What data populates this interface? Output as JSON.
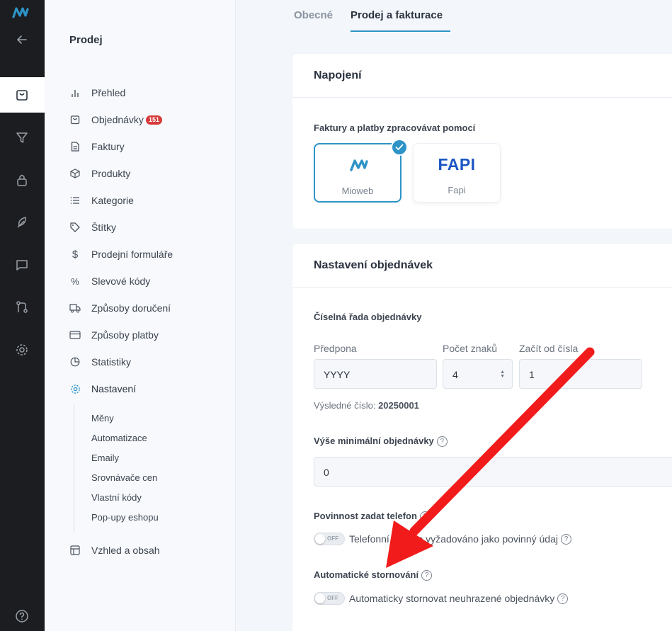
{
  "rail": {
    "icons": [
      "mioweb-logo-icon",
      "back-arrow-icon",
      "shopping-bag-icon",
      "funnel-icon",
      "lock-icon",
      "feather-icon",
      "chat-icon",
      "git-branch-icon",
      "gear-icon",
      "help-icon"
    ]
  },
  "sidebar": {
    "title": "Prodej",
    "items": [
      {
        "label": "Přehled",
        "icon": "bar-chart-icon"
      },
      {
        "label": "Objednávky",
        "icon": "bag-icon",
        "badge": "151"
      },
      {
        "label": "Faktury",
        "icon": "document-icon"
      },
      {
        "label": "Produkty",
        "icon": "box-icon"
      },
      {
        "label": "Kategorie",
        "icon": "list-icon"
      },
      {
        "label": "Štítky",
        "icon": "tag-icon"
      },
      {
        "label": "Prodejní formuláře",
        "icon": "dollar-icon"
      },
      {
        "label": "Slevové kódy",
        "icon": "percent-icon"
      },
      {
        "label": "Způsoby doručení",
        "icon": "truck-icon"
      },
      {
        "label": "Způsoby platby",
        "icon": "credit-card-icon"
      },
      {
        "label": "Statistiky",
        "icon": "pie-chart-icon"
      },
      {
        "label": "Nastavení",
        "icon": "gear-icon"
      },
      {
        "label": "Vzhled a obsah",
        "icon": "layout-icon"
      }
    ],
    "subitems": [
      "Měny",
      "Automatizace",
      "Emaily",
      "Srovnávače cen",
      "Vlastní kódy",
      "Pop-upy eshopu"
    ],
    "accent": "#2e93c6"
  },
  "tabs": [
    {
      "label": "Obecné"
    },
    {
      "label": "Prodej a fakturace"
    }
  ],
  "connection": {
    "title": "Napojení",
    "label": "Faktury a platby zpracovávat pomocí",
    "providers": [
      {
        "name": "Mioweb",
        "selected": true
      },
      {
        "name": "Fapi",
        "logo_text": "FAPI",
        "selected": false
      }
    ]
  },
  "orders": {
    "title": "Nastavení objednávek",
    "series_label": "Číselná řada objednávky",
    "prefix_label": "Předpona",
    "prefix_value": "YYYY",
    "digits_label": "Počet znaků",
    "digits_value": "4",
    "start_label": "Začít od čísla",
    "start_value": "1",
    "result_label": "Výsledné číslo:",
    "result_value": "20250001",
    "min_label": "Výše minimální objednávky",
    "min_value": "0",
    "phone_label": "Povinnost zadat telefon",
    "phone_toggle_text": "Telefonní číslo je vyžadováno jako povinný údaj",
    "cancel_label": "Automatické stornování",
    "cancel_toggle_text": "Automaticky stornovat neuhrazené objednávky",
    "toggle_off_text": "OFF",
    "help_glyph": "?"
  },
  "annotation": {
    "arrow_color": "#f21b1b"
  }
}
